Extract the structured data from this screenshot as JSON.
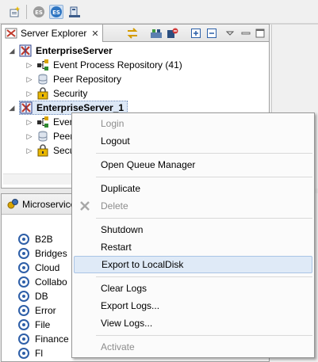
{
  "toolbar": {
    "items": [
      {
        "icon": "new-connection-icon"
      },
      {
        "icon": "es-gray-icon",
        "text": "ES"
      },
      {
        "icon": "es-active-icon",
        "text": "ES"
      },
      {
        "icon": "deploy-icon"
      }
    ]
  },
  "explorer": {
    "tab_title": "Server Explorer",
    "close_glyph": "✕",
    "view_buttons": [
      "sync-icon",
      "deploy-icon",
      "refresh-stop-icon",
      "expand-all-icon",
      "collapse-all-icon",
      "view-menu-icon"
    ],
    "tree": [
      {
        "label": "EnterpriseServer",
        "level": 0,
        "expanded": true,
        "icon": "enterprise-server-icon",
        "bold": true
      },
      {
        "label": "Event Process Repository (41)",
        "level": 1,
        "expanded": false,
        "icon": "event-process-icon"
      },
      {
        "label": "Peer Repository",
        "level": 1,
        "expanded": false,
        "icon": "peer-repository-icon"
      },
      {
        "label": "Security",
        "level": 1,
        "expanded": false,
        "icon": "security-icon"
      },
      {
        "label": "EnterpriseServer_1",
        "level": 0,
        "expanded": true,
        "icon": "enterprise-server-icon",
        "bold": true,
        "selected": true
      },
      {
        "label": "Even",
        "level": 1,
        "expanded": false,
        "icon": "event-process-icon"
      },
      {
        "label": "Peer",
        "level": 1,
        "expanded": false,
        "icon": "peer-repository-icon"
      },
      {
        "label": "Secu",
        "level": 1,
        "expanded": false,
        "icon": "security-icon"
      }
    ]
  },
  "microservices": {
    "tab_title": "Microservice",
    "items": [
      "B2B",
      "Bridges",
      "Cloud",
      "Collabo",
      "DB",
      "Error",
      "File",
      "Finance",
      "Fl"
    ]
  },
  "context_menu": {
    "items": [
      {
        "label": "Login",
        "disabled": true
      },
      {
        "label": "Logout",
        "disabled": false
      },
      {
        "separator": true
      },
      {
        "label": "Open Queue Manager",
        "disabled": false
      },
      {
        "separator": true
      },
      {
        "label": "Duplicate",
        "disabled": false
      },
      {
        "label": "Delete",
        "disabled": true,
        "icon": "delete-icon"
      },
      {
        "separator": true
      },
      {
        "label": "Shutdown",
        "disabled": false
      },
      {
        "label": "Restart",
        "disabled": false
      },
      {
        "label": "Export to LocalDisk",
        "disabled": false,
        "hover": true
      },
      {
        "separator": true
      },
      {
        "label": "Clear Logs",
        "disabled": false
      },
      {
        "label": "Export Logs...",
        "disabled": false
      },
      {
        "label": "View Logs...",
        "disabled": false
      },
      {
        "separator": true
      },
      {
        "label": "Activate",
        "disabled": true
      }
    ]
  },
  "colors": {
    "selection": "#dde8f6",
    "menu_hover": "#dfeaf7",
    "disabled_text": "#8d8d8d"
  }
}
